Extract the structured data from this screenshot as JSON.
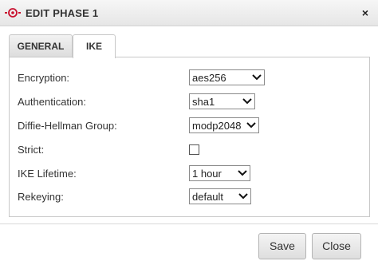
{
  "dialog": {
    "title": "EDIT PHASE 1",
    "close_glyph": "×",
    "logo_icon": "target-logo-icon",
    "accent_color": "#c8102e"
  },
  "tabs": [
    {
      "label": "GENERAL",
      "active": false
    },
    {
      "label": "IKE",
      "active": true
    }
  ],
  "form": {
    "encryption": {
      "label": "Encryption:",
      "value": "aes256"
    },
    "authentication": {
      "label": "Authentication:",
      "value": "sha1"
    },
    "dh_group": {
      "label": "Diffie-Hellman Group:",
      "value": "modp2048"
    },
    "strict": {
      "label": "Strict:",
      "checked": false
    },
    "ike_lifetime": {
      "label": "IKE Lifetime:",
      "value": "1 hour"
    },
    "rekeying": {
      "label": "Rekeying:",
      "value": "default"
    }
  },
  "footer": {
    "save_label": "Save",
    "close_label": "Close"
  }
}
